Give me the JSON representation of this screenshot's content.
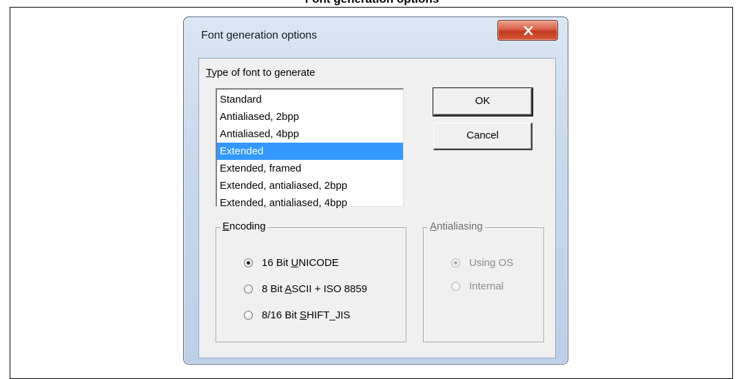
{
  "page": {
    "heading": "Font generation options"
  },
  "dialog": {
    "title": "Font generation options",
    "close_icon": "close-x-icon",
    "font_type": {
      "label_prefix": "",
      "label_accel": "T",
      "label_rest": "ype of font to generate",
      "items": [
        "Standard",
        "Antialiased, 2bpp",
        "Antialiased, 4bpp",
        "Extended",
        "Extended, framed",
        "Extended, antialiased, 2bpp",
        "Extended, antialiased, 4bpp"
      ],
      "selected_index": 3
    },
    "buttons": {
      "ok": "OK",
      "cancel": "Cancel"
    },
    "encoding": {
      "legend_accel": "E",
      "legend_rest": "ncoding",
      "options": [
        {
          "pre": "16 Bit ",
          "accel": "U",
          "post": "NICODE",
          "checked": true
        },
        {
          "pre": "8 Bit ",
          "accel": "A",
          "post": "SCII + ISO 8859",
          "checked": false
        },
        {
          "pre": "8/16 Bit ",
          "accel": "S",
          "post": "HIFT_JIS",
          "checked": false
        }
      ]
    },
    "antialiasing": {
      "legend_accel": "A",
      "legend_rest": "ntialiasing",
      "enabled": false,
      "options": [
        {
          "label": "Using OS",
          "checked": true
        },
        {
          "label": "Internal",
          "checked": false
        }
      ]
    }
  },
  "colors": {
    "selection": "#3399ff",
    "dialog_face": "#f0f0f0",
    "close_button": "#c4391f"
  }
}
